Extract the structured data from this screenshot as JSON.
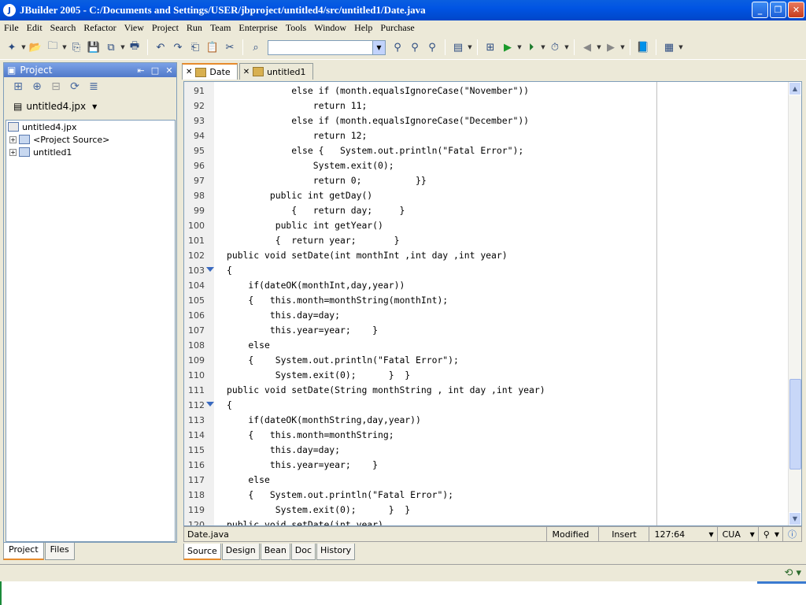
{
  "window": {
    "title": "JBuilder 2005 - C:/Documents and Settings/USER/jbproject/untitled4/src/untitled1/Date.java"
  },
  "menu": [
    "File",
    "Edit",
    "Search",
    "Refactor",
    "View",
    "Project",
    "Run",
    "Team",
    "Enterprise",
    "Tools",
    "Window",
    "Help",
    "Purchase"
  ],
  "project_panel": {
    "title": "Project",
    "selected_project": "untitled4.jpx",
    "tree": [
      {
        "label": "untitled4.jpx",
        "expandable": false
      },
      {
        "label": "<Project Source>",
        "expandable": true
      },
      {
        "label": "untitled1",
        "expandable": true
      }
    ],
    "tabs": [
      "Project",
      "Files"
    ],
    "active_tab": "Project"
  },
  "editor_tabs": [
    {
      "label": "Date",
      "active": true
    },
    {
      "label": "untitled1",
      "active": false
    }
  ],
  "code_lines": [
    {
      "n": "91",
      "text": "            else if (month.equalsIgnoreCase(\"November\"))"
    },
    {
      "n": "92",
      "text": "                return 11;"
    },
    {
      "n": "93",
      "text": "            else if (month.equalsIgnoreCase(\"December\"))"
    },
    {
      "n": "94",
      "text": "                return 12;"
    },
    {
      "n": "95",
      "text": "            else {   System.out.println(\"Fatal Error\");"
    },
    {
      "n": "96",
      "text": "                System.exit(0);"
    },
    {
      "n": "97",
      "text": "                return 0;          }}"
    },
    {
      "n": "98",
      "text": "        public int getDay()"
    },
    {
      "n": "99",
      "text": "            {   return day;     }"
    },
    {
      "n": "100",
      "text": "         public int getYear()"
    },
    {
      "n": "101",
      "text": "         {  return year;       }"
    },
    {
      "n": "102",
      "text": "public void setDate(int monthInt ,int day ,int year)"
    },
    {
      "n": "103",
      "text": "{",
      "fold": true
    },
    {
      "n": "104",
      "text": "    if(dateOK(monthInt,day,year))"
    },
    {
      "n": "105",
      "text": "    {   this.month=monthString(monthInt);"
    },
    {
      "n": "106",
      "text": "        this.day=day;"
    },
    {
      "n": "107",
      "text": "        this.year=year;    }"
    },
    {
      "n": "108",
      "text": "    else"
    },
    {
      "n": "109",
      "text": "    {    System.out.println(\"Fatal Error\");"
    },
    {
      "n": "110",
      "text": "         System.exit(0);      }  }"
    },
    {
      "n": "111",
      "text": "public void setDate(String monthString , int day ,int year)"
    },
    {
      "n": "112",
      "text": "{",
      "fold": true
    },
    {
      "n": "113",
      "text": "    if(dateOK(monthString,day,year))"
    },
    {
      "n": "114",
      "text": "    {   this.month=monthString;"
    },
    {
      "n": "115",
      "text": "        this.day=day;"
    },
    {
      "n": "116",
      "text": "        this.year=year;    }"
    },
    {
      "n": "117",
      "text": "    else"
    },
    {
      "n": "118",
      "text": "    {   System.out.println(\"Fatal Error\");"
    },
    {
      "n": "119",
      "text": "         System.exit(0);      }  }"
    },
    {
      "n": "120",
      "text": "public void setDate(int year)"
    }
  ],
  "status": {
    "file": "Date.java",
    "modified": "Modified",
    "mode": "Insert",
    "position": "127:64",
    "keymap": "CUA"
  },
  "source_tabs": [
    "Source",
    "Design",
    "Bean",
    "Doc",
    "History"
  ],
  "active_source_tab": "Source"
}
